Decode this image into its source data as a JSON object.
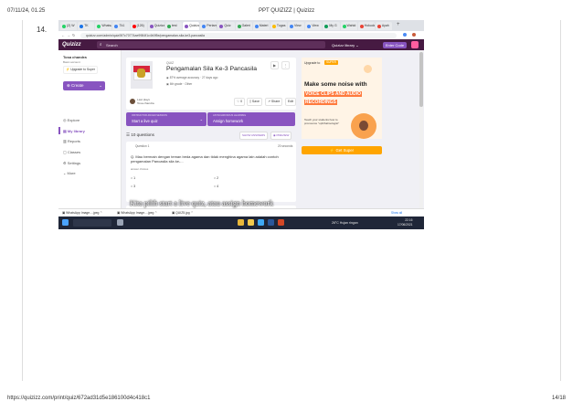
{
  "print_header": {
    "datetime": "07/11/24, 01.25",
    "title": "PPT QUIZIZZ | Quizizz"
  },
  "slide_number": "14.",
  "browser": {
    "tabs": [
      "(2) W",
      "TK",
      "WhatsA",
      "Tk1",
      "(126)",
      "Quizizz",
      "test",
      "Quizizz",
      "Pertanyaa",
      "Quiz",
      "Galeri",
      "Materi",
      "Tugas",
      "View",
      "View",
      "My G",
      "Wahid",
      "Hokudal",
      "Ayah"
    ],
    "url": "quizizz.com/admin/quiz/5f7c70774ae9984f1c4b0f5e/pengamalan-sila-ke3-pancasila"
  },
  "quizizz_header": {
    "logo": "Quizizz",
    "search_placeholder": "Search",
    "library": "Quizizz library",
    "enter_code": "Enter Code"
  },
  "sidebar": {
    "user_name": "Tosa chandra",
    "account": "Basic account",
    "upgrade": "Upgrade to Super",
    "create": "Create",
    "items": [
      "Explore",
      "My library",
      "Reports",
      "Classes",
      "Settings",
      "More"
    ],
    "help": "Help"
  },
  "quiz": {
    "type": "QUIZ",
    "title": "Pengamalan Sila Ke-3 Pancasila",
    "accuracy": "87% average accuracy",
    "time": "27 days ago",
    "grade": "6th grade",
    "subject": "Other",
    "owner_label": "Last plays",
    "owner": "Tosa chandra",
    "likes": "0",
    "save": "Save",
    "share": "Share",
    "edit": "Edit"
  },
  "actions": {
    "start_sub": "INSTRUCTOR-PACED SESSION",
    "start_main": "Start a live quiz",
    "assign_sub": "ASYNCHRONOUS LEARNING",
    "assign_main": "Assign homework"
  },
  "questions": {
    "count": "10 questions",
    "show_answers": "SHOW ANSWERS",
    "preview": "PREVIEW",
    "q1_label": "Question 1",
    "q1_time": "20 seconds",
    "q1_text": "Q. Mau bermain dengan teman beda agama dan tidak menghina agama lain adalah contoh pengamalan Pancasila sila ke-...",
    "answer_label": "answer choices",
    "options": [
      "1",
      "2",
      "3",
      "4"
    ]
  },
  "ad": {
    "upgrade_to": "Upgrade to",
    "super": "SUPER",
    "headline": "Make some noise with",
    "highlight1": "VOICE CLIPS AND AUDIO",
    "highlight2": "RECORDINGS",
    "teach": "Teach your students how to pronounce \"ophthalmologist\"",
    "get_super": "Get Super"
  },
  "overlay_text": "Kita pilih start a live quiz, atau assign homework",
  "downloads": {
    "items": [
      "WhatsApp Image....jpeg",
      "WhatsApp Image....jpeg",
      "QUIZ5.jpg"
    ],
    "show_all": "Show all"
  },
  "taskbar": {
    "weather": "26°C Hujan ringan",
    "time": "22.16",
    "date": "17/06/2021"
  },
  "print_footer": {
    "url": "https://quizizz.com/print/quiz/672ad31d5e186100d4c418c1",
    "page": "14/18"
  },
  "colors": {
    "brand": "#461a42",
    "accent": "#8854c0",
    "super": "#ffa500",
    "ad_bg": "#fff4e6"
  }
}
